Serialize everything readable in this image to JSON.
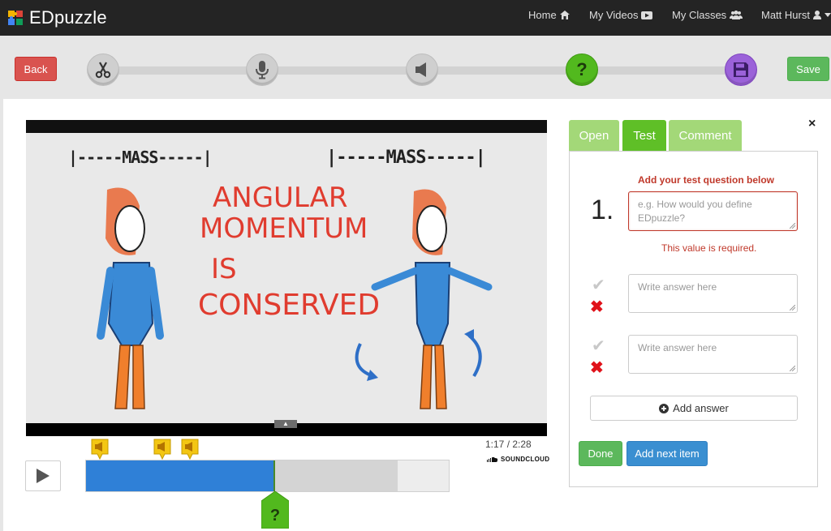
{
  "navbar": {
    "brand": "EDpuzzle",
    "items": [
      {
        "label": "Home",
        "icon": "home-icon"
      },
      {
        "label": "My Videos",
        "icon": "video-icon"
      },
      {
        "label": "My Classes",
        "icon": "users-icon"
      },
      {
        "label": "Matt Hurst",
        "icon": "user-icon"
      }
    ]
  },
  "toolbar": {
    "back_label": "Back",
    "save_label": "Save",
    "steps": [
      {
        "name": "cut",
        "icon": "scissors-icon",
        "active": false
      },
      {
        "name": "voiceover",
        "icon": "microphone-icon",
        "active": false
      },
      {
        "name": "audio-notes",
        "icon": "speaker-icon",
        "active": false
      },
      {
        "name": "quiz",
        "icon": "question-icon",
        "active": true
      },
      {
        "name": "finish",
        "icon": "floppy-disk-icon",
        "active": false
      }
    ]
  },
  "video": {
    "frame_text": {
      "left_mass": "|-----MASS-----|",
      "right_mass": "|-----MASS-----|",
      "line1": "ANGULAR",
      "line2": "MOMENTUM",
      "line3": "IS",
      "line4": "CONSERVED"
    },
    "current_time": "1:17",
    "duration": "2:28",
    "time_display": "1:17 / 2:28",
    "soundcloud_label": "SOUNDCLOUD",
    "played_fraction": 0.52,
    "buffered_fraction": 0.86,
    "audio_marker_icon": "speaker-icon",
    "question_marker_icon": "question-icon"
  },
  "editor": {
    "tabs": [
      {
        "label": "Open",
        "active": false
      },
      {
        "label": "Test",
        "active": true
      },
      {
        "label": "Comment",
        "active": false
      }
    ],
    "close_label": "×",
    "prompt": "Add your test question below",
    "question_number": "1.",
    "question_placeholder": "e.g. How would you define EDpuzzle?",
    "error_message": "This value is required.",
    "answers": [
      {
        "placeholder": "Write answer here",
        "correct": false
      },
      {
        "placeholder": "Write answer here",
        "correct": false
      }
    ],
    "add_answer_label": "Add answer",
    "done_label": "Done",
    "add_next_label": "Add next item"
  },
  "colors": {
    "navbar": "#242424",
    "green": "#5cb85c",
    "red": "#d9534f",
    "blue": "#3a8fd1",
    "timeline_played": "#2f80d7",
    "error": "#c0392b"
  }
}
